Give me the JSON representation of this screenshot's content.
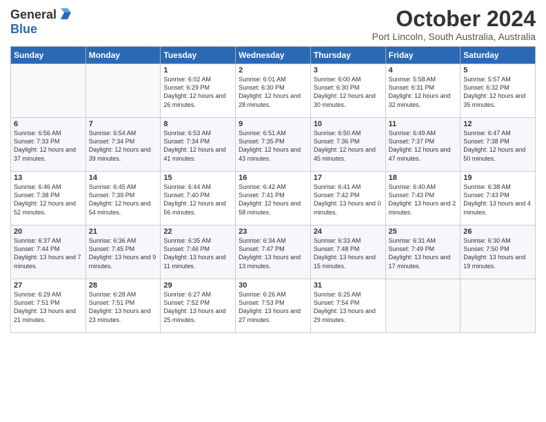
{
  "logo": {
    "general": "General",
    "blue": "Blue"
  },
  "header": {
    "month": "October 2024",
    "location": "Port Lincoln, South Australia, Australia"
  },
  "days_of_week": [
    "Sunday",
    "Monday",
    "Tuesday",
    "Wednesday",
    "Thursday",
    "Friday",
    "Saturday"
  ],
  "weeks": [
    [
      {
        "day": "",
        "sunrise": "",
        "sunset": "",
        "daylight": ""
      },
      {
        "day": "",
        "sunrise": "",
        "sunset": "",
        "daylight": ""
      },
      {
        "day": "1",
        "sunrise": "Sunrise: 6:02 AM",
        "sunset": "Sunset: 6:29 PM",
        "daylight": "Daylight: 12 hours and 26 minutes."
      },
      {
        "day": "2",
        "sunrise": "Sunrise: 6:01 AM",
        "sunset": "Sunset: 6:30 PM",
        "daylight": "Daylight: 12 hours and 28 minutes."
      },
      {
        "day": "3",
        "sunrise": "Sunrise: 6:00 AM",
        "sunset": "Sunset: 6:30 PM",
        "daylight": "Daylight: 12 hours and 30 minutes."
      },
      {
        "day": "4",
        "sunrise": "Sunrise: 5:58 AM",
        "sunset": "Sunset: 6:31 PM",
        "daylight": "Daylight: 12 hours and 32 minutes."
      },
      {
        "day": "5",
        "sunrise": "Sunrise: 5:57 AM",
        "sunset": "Sunset: 6:32 PM",
        "daylight": "Daylight: 12 hours and 35 minutes."
      }
    ],
    [
      {
        "day": "6",
        "sunrise": "Sunrise: 6:56 AM",
        "sunset": "Sunset: 7:33 PM",
        "daylight": "Daylight: 12 hours and 37 minutes."
      },
      {
        "day": "7",
        "sunrise": "Sunrise: 6:54 AM",
        "sunset": "Sunset: 7:34 PM",
        "daylight": "Daylight: 12 hours and 39 minutes."
      },
      {
        "day": "8",
        "sunrise": "Sunrise: 6:53 AM",
        "sunset": "Sunset: 7:34 PM",
        "daylight": "Daylight: 12 hours and 41 minutes."
      },
      {
        "day": "9",
        "sunrise": "Sunrise: 6:51 AM",
        "sunset": "Sunset: 7:35 PM",
        "daylight": "Daylight: 12 hours and 43 minutes."
      },
      {
        "day": "10",
        "sunrise": "Sunrise: 6:50 AM",
        "sunset": "Sunset: 7:36 PM",
        "daylight": "Daylight: 12 hours and 45 minutes."
      },
      {
        "day": "11",
        "sunrise": "Sunrise: 6:49 AM",
        "sunset": "Sunset: 7:37 PM",
        "daylight": "Daylight: 12 hours and 47 minutes."
      },
      {
        "day": "12",
        "sunrise": "Sunrise: 6:47 AM",
        "sunset": "Sunset: 7:38 PM",
        "daylight": "Daylight: 12 hours and 50 minutes."
      }
    ],
    [
      {
        "day": "13",
        "sunrise": "Sunrise: 6:46 AM",
        "sunset": "Sunset: 7:38 PM",
        "daylight": "Daylight: 12 hours and 52 minutes."
      },
      {
        "day": "14",
        "sunrise": "Sunrise: 6:45 AM",
        "sunset": "Sunset: 7:39 PM",
        "daylight": "Daylight: 12 hours and 54 minutes."
      },
      {
        "day": "15",
        "sunrise": "Sunrise: 6:44 AM",
        "sunset": "Sunset: 7:40 PM",
        "daylight": "Daylight: 12 hours and 56 minutes."
      },
      {
        "day": "16",
        "sunrise": "Sunrise: 6:42 AM",
        "sunset": "Sunset: 7:41 PM",
        "daylight": "Daylight: 12 hours and 58 minutes."
      },
      {
        "day": "17",
        "sunrise": "Sunrise: 6:41 AM",
        "sunset": "Sunset: 7:42 PM",
        "daylight": "Daylight: 13 hours and 0 minutes."
      },
      {
        "day": "18",
        "sunrise": "Sunrise: 6:40 AM",
        "sunset": "Sunset: 7:43 PM",
        "daylight": "Daylight: 13 hours and 2 minutes."
      },
      {
        "day": "19",
        "sunrise": "Sunrise: 6:38 AM",
        "sunset": "Sunset: 7:43 PM",
        "daylight": "Daylight: 13 hours and 4 minutes."
      }
    ],
    [
      {
        "day": "20",
        "sunrise": "Sunrise: 6:37 AM",
        "sunset": "Sunset: 7:44 PM",
        "daylight": "Daylight: 13 hours and 7 minutes."
      },
      {
        "day": "21",
        "sunrise": "Sunrise: 6:36 AM",
        "sunset": "Sunset: 7:45 PM",
        "daylight": "Daylight: 13 hours and 9 minutes."
      },
      {
        "day": "22",
        "sunrise": "Sunrise: 6:35 AM",
        "sunset": "Sunset: 7:46 PM",
        "daylight": "Daylight: 13 hours and 11 minutes."
      },
      {
        "day": "23",
        "sunrise": "Sunrise: 6:34 AM",
        "sunset": "Sunset: 7:47 PM",
        "daylight": "Daylight: 13 hours and 13 minutes."
      },
      {
        "day": "24",
        "sunrise": "Sunrise: 6:33 AM",
        "sunset": "Sunset: 7:48 PM",
        "daylight": "Daylight: 13 hours and 15 minutes."
      },
      {
        "day": "25",
        "sunrise": "Sunrise: 6:31 AM",
        "sunset": "Sunset: 7:49 PM",
        "daylight": "Daylight: 13 hours and 17 minutes."
      },
      {
        "day": "26",
        "sunrise": "Sunrise: 6:30 AM",
        "sunset": "Sunset: 7:50 PM",
        "daylight": "Daylight: 13 hours and 19 minutes."
      }
    ],
    [
      {
        "day": "27",
        "sunrise": "Sunrise: 6:29 AM",
        "sunset": "Sunset: 7:51 PM",
        "daylight": "Daylight: 13 hours and 21 minutes."
      },
      {
        "day": "28",
        "sunrise": "Sunrise: 6:28 AM",
        "sunset": "Sunset: 7:51 PM",
        "daylight": "Daylight: 13 hours and 23 minutes."
      },
      {
        "day": "29",
        "sunrise": "Sunrise: 6:27 AM",
        "sunset": "Sunset: 7:52 PM",
        "daylight": "Daylight: 13 hours and 25 minutes."
      },
      {
        "day": "30",
        "sunrise": "Sunrise: 6:26 AM",
        "sunset": "Sunset: 7:53 PM",
        "daylight": "Daylight: 13 hours and 27 minutes."
      },
      {
        "day": "31",
        "sunrise": "Sunrise: 6:25 AM",
        "sunset": "Sunset: 7:54 PM",
        "daylight": "Daylight: 13 hours and 29 minutes."
      },
      {
        "day": "",
        "sunrise": "",
        "sunset": "",
        "daylight": ""
      },
      {
        "day": "",
        "sunrise": "",
        "sunset": "",
        "daylight": ""
      }
    ]
  ]
}
